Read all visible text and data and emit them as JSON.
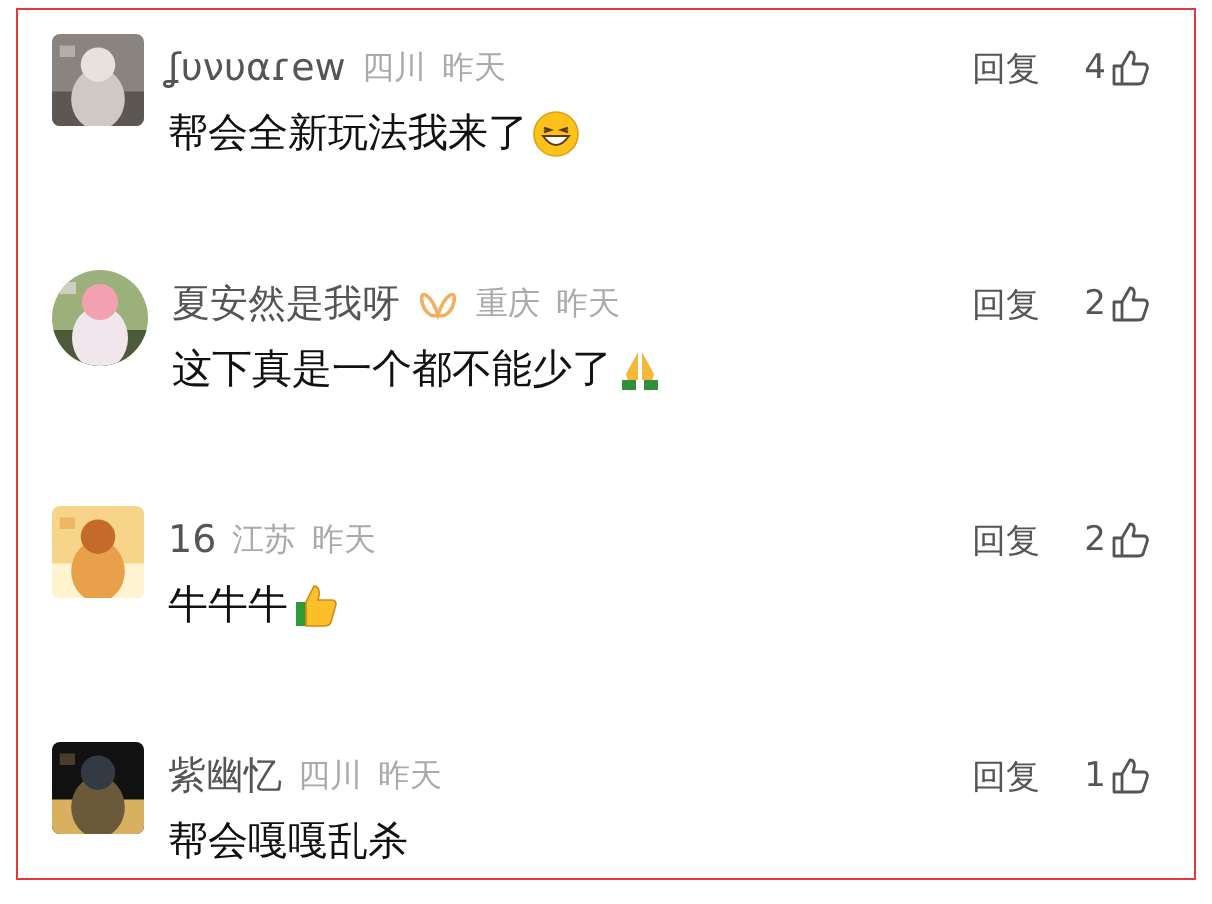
{
  "comments": [
    {
      "name": "ʆυνυαɾew",
      "badge": false,
      "avatar": {
        "kind": "square"
      },
      "location": "四川",
      "time": "昨天",
      "reply": "回复",
      "likes": "4",
      "text": "帮会全新玩法我来了",
      "emoji": {
        "kind": "grin"
      }
    },
    {
      "name": "夏安然是我呀",
      "badge": true,
      "avatar": {
        "kind": "circle"
      },
      "location": "重庆",
      "time": "昨天",
      "reply": "回复",
      "likes": "2",
      "text": "这下真是一个都不能少了",
      "emoji": {
        "kind": "pray"
      }
    },
    {
      "name": "16",
      "badge": false,
      "avatar": {
        "kind": "square"
      },
      "location": "江苏",
      "time": "昨天",
      "reply": "回复",
      "likes": "2",
      "text": "牛牛牛",
      "emoji": {
        "kind": "thumbs"
      }
    },
    {
      "name": "紫幽忆",
      "badge": false,
      "avatar": {
        "kind": "square"
      },
      "location": "四川",
      "time": "昨天",
      "reply": "回复",
      "likes": "1",
      "text": "帮会嘎嘎乱杀"
    }
  ]
}
